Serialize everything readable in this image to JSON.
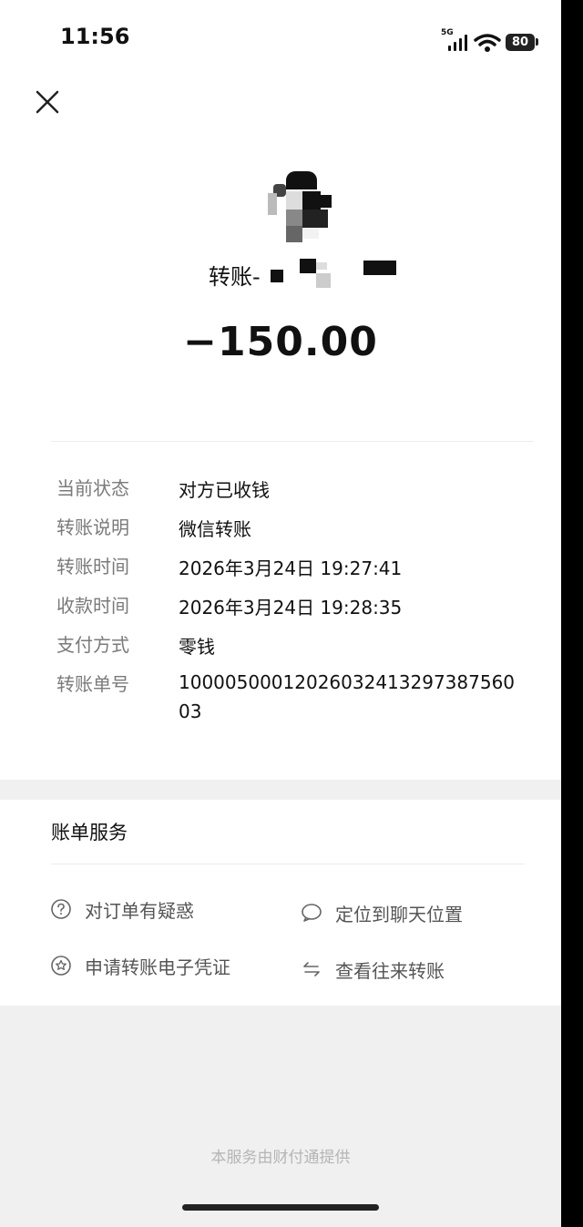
{
  "status_bar": {
    "time": "11:56",
    "network": "5G",
    "battery": "80"
  },
  "header": {
    "title": "转账-",
    "amount": "−150.00"
  },
  "details": [
    {
      "label": "当前状态",
      "value": "对方已收钱"
    },
    {
      "label": "转账说明",
      "value": "微信转账"
    },
    {
      "label": "转账时间",
      "value": "2026年3月24日 19:27:41"
    },
    {
      "label": "收款时间",
      "value": "2026年3月24日 19:28:35"
    },
    {
      "label": "支付方式",
      "value": "零钱"
    },
    {
      "label": "转账单号",
      "value": "1000050001202603241329738756003"
    }
  ],
  "services": {
    "title": "账单服务",
    "items": [
      {
        "label": "对订单有疑惑",
        "icon": "question-circle-icon"
      },
      {
        "label": "定位到聊天位置",
        "icon": "chat-bubble-icon"
      },
      {
        "label": "申请转账电子凭证",
        "icon": "star-badge-icon"
      },
      {
        "label": "查看往来转账",
        "icon": "transfer-arrows-icon"
      }
    ]
  },
  "footer": "本服务由财付通提供"
}
